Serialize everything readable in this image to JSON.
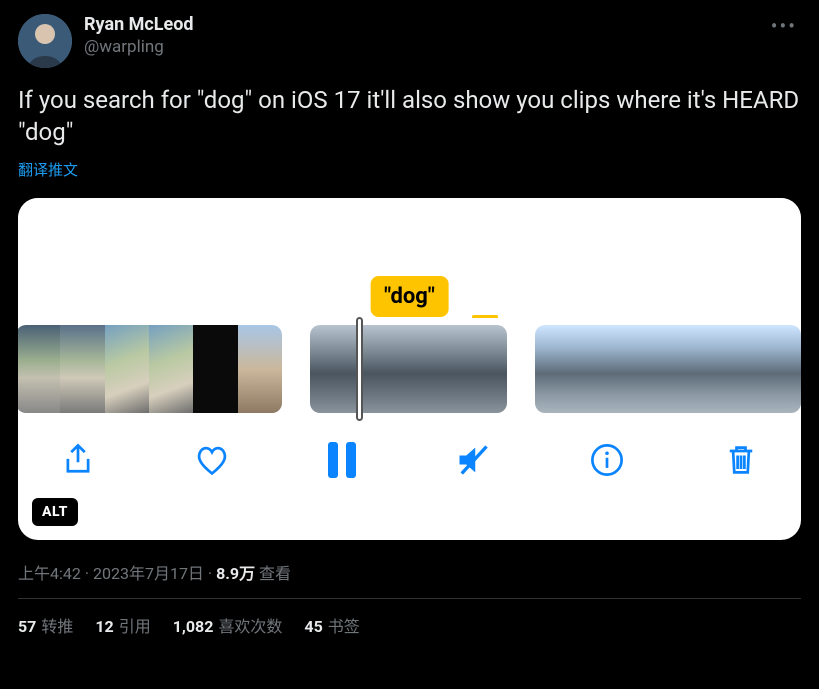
{
  "author": {
    "display_name": "Ryan McLeod",
    "handle": "@warpling"
  },
  "more_label": "•••",
  "body": "If you search for \"dog\" on iOS 17 it'll also show you clips where it's HEARD \"dog\"",
  "translate_label": "翻译推文",
  "media": {
    "caption_pill": "\"dog\"",
    "alt_badge": "ALT",
    "toolbar_icons": {
      "share": "share-icon",
      "heart": "heart-icon",
      "pause": "pause-icon",
      "mute": "mute-icon",
      "info": "info-icon",
      "trash": "trash-icon"
    }
  },
  "meta": {
    "time": "上午4:42",
    "dot1": " · ",
    "date": "2023年7月17日",
    "dot2": " · ",
    "views_count": "8.9万",
    "views_label": " 查看"
  },
  "stats": {
    "retweets": {
      "count": "57",
      "label": "转推"
    },
    "quotes": {
      "count": "12",
      "label": "引用"
    },
    "likes": {
      "count": "1,082",
      "label": "喜欢次数"
    },
    "bookmarks": {
      "count": "45",
      "label": "书签"
    }
  }
}
